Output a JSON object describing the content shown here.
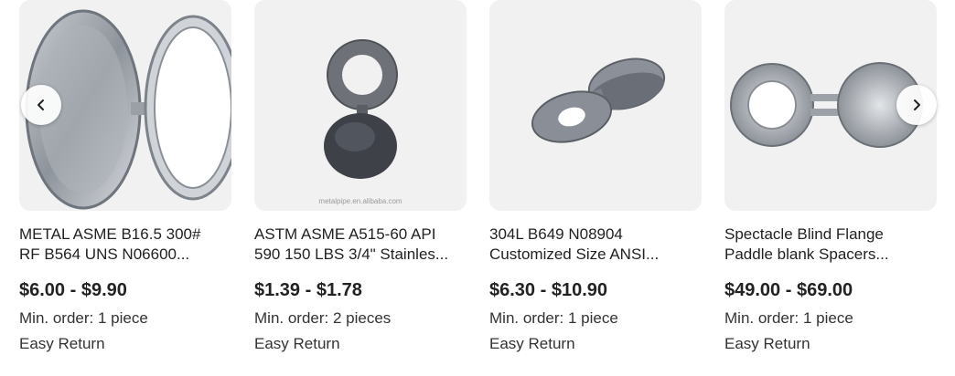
{
  "products": [
    {
      "title_line1": "METAL ASME B16.5 300#",
      "title_line2": "RF B564 UNS N06600...",
      "price": "$6.00 - $9.90",
      "min_order": "Min. order: 1 piece",
      "badge": "Easy Return",
      "image_icon": "spectacle-blind-flange-image"
    },
    {
      "title_line1": "ASTM ASME A515-60 API",
      "title_line2": "590 150 LBS 3/4\" Stainles...",
      "price": "$1.39 - $1.78",
      "min_order": "Min. order: 2 pieces",
      "badge": "Easy Return",
      "image_icon": "spectacle-blind-flange-image",
      "watermark": "metalpipe.en.alibaba.com"
    },
    {
      "title_line1": "304L B649 N08904",
      "title_line2": "Customized Size ANSI...",
      "price": "$6.30 - $10.90",
      "min_order": "Min. order: 1 piece",
      "badge": "Easy Return",
      "image_icon": "spectacle-blind-flange-image"
    },
    {
      "title_line1": "Spectacle Blind Flange",
      "title_line2": "Paddle blank Spacers...",
      "price": "$49.00 - $69.00",
      "min_order": "Min. order: 1 piece",
      "badge": "Easy Return",
      "image_icon": "spectacle-blind-flange-image"
    }
  ],
  "nav": {
    "prev_icon": "chevron-left-icon",
    "next_icon": "chevron-right-icon"
  }
}
